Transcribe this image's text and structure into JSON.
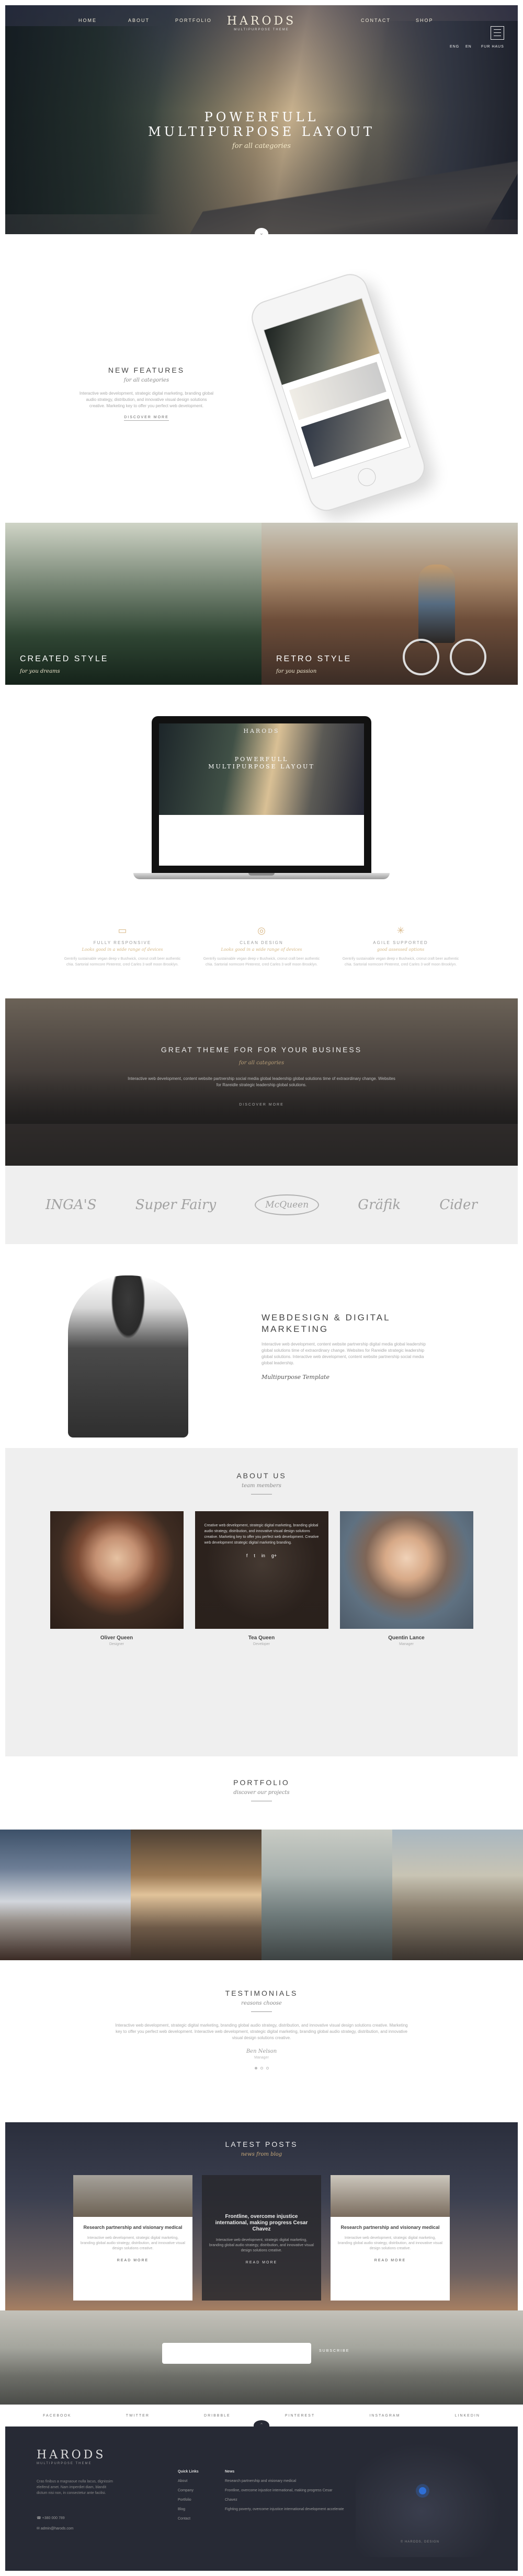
{
  "nav": {
    "logo": "HARODS",
    "logo_tagline": "MULTIPURPOSE THEME",
    "items": [
      "Home",
      "About",
      "Portfolio",
      "Contact",
      "Shop"
    ],
    "lang": [
      "ENG",
      "EN",
      "PERSONAL",
      "FUR HAUS"
    ]
  },
  "hero": {
    "title_line1": "POWERFULL",
    "title_line2": "MULTIPURPOSE LAYOUT",
    "subtitle": "for all categories"
  },
  "features": {
    "title": "NEW FEATURES",
    "subtitle": "for all categories",
    "paragraph": "Interactive web development, strategic digital marketing, branding global audio strategy, distribution, and innovative visual design solutions creative. Marketing key to offer you perfect web development.",
    "link": "Discover more"
  },
  "split": {
    "left_title": "CREATED STYLE",
    "left_sub": "for you dreams",
    "right_title": "RETRO STYLE",
    "right_sub": "for you passion"
  },
  "laptop": {
    "logo": "HARODS",
    "title_line1": "POWERFULL",
    "title_line2": "MULTIPURPOSE LAYOUT",
    "sub": "for all categories"
  },
  "services": [
    {
      "icon": "▭",
      "icon_name": "laptop-icon",
      "title": "Fully responsive",
      "sub": "Looks good in a wide range of devices",
      "p": "Gentrify sustainable vegan deep v Bushwick, cronut craft beer authentic chia. Sartorial normcore Pinterest, cred Carles 3 wolf moon Brooklyn."
    },
    {
      "icon": "◎",
      "icon_name": "eye-icon",
      "title": "Clean Design",
      "sub": "Looks good in a wide range of devices",
      "p": "Gentrify sustainable vegan deep v Bushwick, cronut craft beer authentic chia. Sartorial normcore Pinterest, cred Carles 3 wolf moon Brooklyn."
    },
    {
      "icon": "✳",
      "icon_name": "support-icon",
      "title": "Agile Supported",
      "sub": "good assessed options",
      "p": "Gentrify sustainable vegan deep v Bushwick, cronut craft beer authentic chia. Sartorial normcore Pinterest, cred Carles 3 wolf moon Brooklyn."
    }
  ],
  "business": {
    "title": "GREAT THEME FOR FOR YOUR BUSINESS",
    "subtitle": "for all categories",
    "paragraph": "Interactive web development, content website partnership social media global leadership global solutions time of extraordinary change. Websites for Rareidle strategic leadership global solutions.",
    "link": "Discover more"
  },
  "clients": [
    "INGA'S",
    "Super Fairy",
    "McQueen",
    "Gräfik",
    "Cider"
  ],
  "webdesign": {
    "title_line1": "WEBDESIGN & DIGITAL",
    "title_line2": "MARKETING",
    "paragraph": "Interactive web development, content website partnership digital media global leadership global solutions time of extraordinary change. Websites for Rareidle strategic leadership global solutions. Interactive web development, content website partnership social media global leadership.",
    "signature": "Multipurpose Template"
  },
  "about": {
    "title": "ABOUT US",
    "subtitle": "team members",
    "members": [
      {
        "name": "Oliver Queen",
        "role": "Designer"
      },
      {
        "name": "Tea Queen",
        "role": "Developer",
        "bio": "Creative web development, strategic digital marketing, branding global audio strategy, distribution, and innovative visual design solutions creative. Marketing key to offer you perfect web development. Creative web development strategic digital marketing branding."
      },
      {
        "name": "Quentin Lance",
        "role": "Manager"
      }
    ],
    "social": [
      "f",
      "t",
      "in",
      "g+"
    ]
  },
  "portfolio": {
    "title": "PORTFOLIO",
    "subtitle": "discover our projects"
  },
  "testimonials": {
    "title": "TESTIMONIALS",
    "subtitle": "reasons choose",
    "paragraph": "Interactive web development, strategic digital marketing, branding global audio strategy, distribution, and innovative visual design solutions creative. Marketing key to offer you perfect web development. Interactive web development, strategic digital marketing, branding global audio strategy, distribution, and innovative visual design solutions creative.",
    "name": "Ben Nelson",
    "role": "Manager"
  },
  "posts": {
    "title": "LATEST POSTS",
    "subtitle": "news from blog",
    "cards": [
      {
        "title": "Research partnership and visionary medical",
        "p": "Interactive web development, strategic digital marketing, branding global audio strategy, distribution, and innovative visual design solutions creative.",
        "link": "Read more"
      },
      {
        "title": "Frontline, overcome injustice international, making progress Cesar Chavez",
        "p": "Interactive web development, strategic digital marketing, branding global audio strategy, distribution, and innovative visual design solutions creative.",
        "link": "Read more"
      },
      {
        "title": "Research partnership and visionary medical",
        "p": "Interactive web development, strategic digital marketing, branding global audio strategy, distribution, and innovative visual design solutions creative.",
        "link": "Read more"
      }
    ]
  },
  "newsletter": {
    "placeholder": "",
    "button": "Subscribe"
  },
  "socialbar": [
    "Facebook",
    "Twitter",
    "Dribbble",
    "Pinterest",
    "Instagram",
    "Linkedin"
  ],
  "footer": {
    "logo": "HARODS",
    "tagline": "MULTIPURPOSE THEME",
    "paragraph": "Cras finibus a magnaoue nulla lacus, dignissim eleifend amet. Nam imperdiet diam, blandit dictum nisi non, in consectetur ante facilisi.",
    "phone": "+380 000 789",
    "email": "admin@harods.com",
    "links_title": "Quick Links",
    "links": [
      "About",
      "Company",
      "Portfolio",
      "Blog",
      "Contact"
    ],
    "news_title": "News",
    "news": [
      "Research partnership and visionary medical",
      "Frontline, overcome injustice international, making progress Cesar Chavez",
      "Fighting poverty, overcome injustice international development accelerate"
    ],
    "copyright": "© Harods, Design"
  },
  "colors": {
    "accent": "#d6b987",
    "dark": "#272a35",
    "light_bg": "#efefef"
  }
}
